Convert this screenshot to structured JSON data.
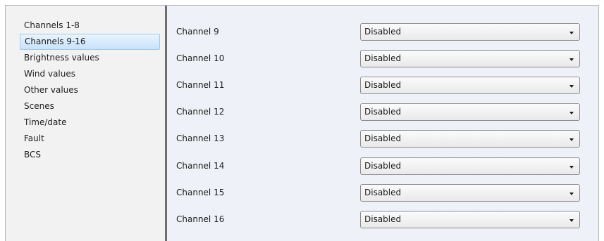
{
  "sidebar": {
    "items": [
      {
        "label": "Channels 1-8"
      },
      {
        "label": "Channels 9-16",
        "selected": true
      },
      {
        "label": "Brightness values"
      },
      {
        "label": "Wind values"
      },
      {
        "label": "Other values"
      },
      {
        "label": "Scenes"
      },
      {
        "label": "Time/date"
      },
      {
        "label": "Fault"
      },
      {
        "label": "BCS"
      }
    ]
  },
  "channels": [
    {
      "label": "Channel 9",
      "value": "Disabled"
    },
    {
      "label": "Channel 10",
      "value": "Disabled"
    },
    {
      "label": "Channel 11",
      "value": "Disabled"
    },
    {
      "label": "Channel 12",
      "value": "Disabled"
    },
    {
      "label": "Channel 13",
      "value": "Disabled"
    },
    {
      "label": "Channel 14",
      "value": "Disabled"
    },
    {
      "label": "Channel 15",
      "value": "Disabled"
    },
    {
      "label": "Channel 16",
      "value": "Disabled"
    }
  ],
  "icons": {
    "dropdown": "chevron-down-icon"
  }
}
